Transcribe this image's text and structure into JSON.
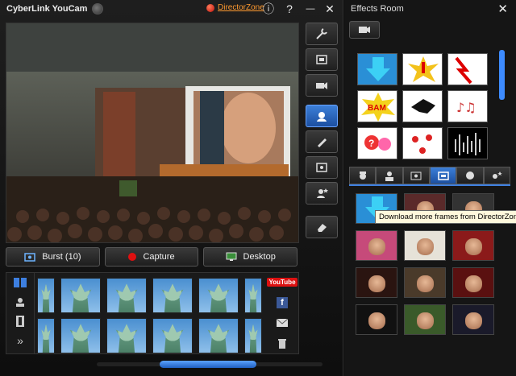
{
  "titlebar": {
    "app_title": "CyberLink YouCam",
    "directorzone_link": "DirectorZone",
    "info_label": "ⓘ",
    "help_label": "?",
    "minimize_label": "—",
    "close_label": "✕"
  },
  "tools": {
    "items": [
      "wrench-icon",
      "frame-icon",
      "camera-icon",
      "face-effects-icon",
      "pen-icon",
      "frame-effect-icon",
      "avatar-icon",
      "eraser-icon"
    ]
  },
  "buttons": {
    "burst": "Burst (10)",
    "capture": "Capture",
    "desktop": "Desktop"
  },
  "share": {
    "youtube_label": "YouTube"
  },
  "effects": {
    "title": "Effects Room",
    "close_label": "✕",
    "tooltip": "Download more frames from DirectorZone"
  },
  "colors": {
    "accent": "#3d7fe0",
    "link": "#ff9a30",
    "capture_red": "#e01010"
  }
}
